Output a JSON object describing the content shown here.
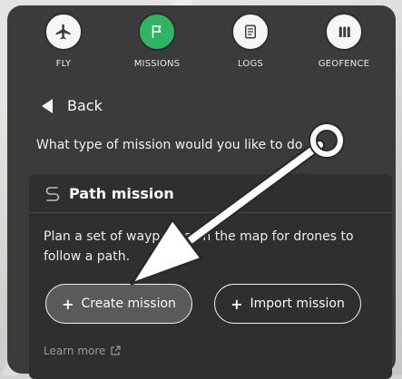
{
  "nav": {
    "items": [
      {
        "label": "FLY",
        "icon": "plane-icon",
        "active": false
      },
      {
        "label": "MISSIONS",
        "icon": "flag-icon",
        "active": true
      },
      {
        "label": "LOGS",
        "icon": "document-icon",
        "active": false
      },
      {
        "label": "GEOFENCE",
        "icon": "fence-icon",
        "active": false
      }
    ]
  },
  "back": {
    "label": "Back"
  },
  "question": "What type of mission would you like to do",
  "card": {
    "title": "Path mission",
    "description": "Plan a set of waypoints on the map for drones to follow a path.",
    "create_label": "Create mission",
    "import_label": "Import mission",
    "learn_more": "Learn more"
  },
  "colors": {
    "panel": "#3b3b3b",
    "card": "#2f2f2f",
    "active_nav": "#2fb463"
  }
}
